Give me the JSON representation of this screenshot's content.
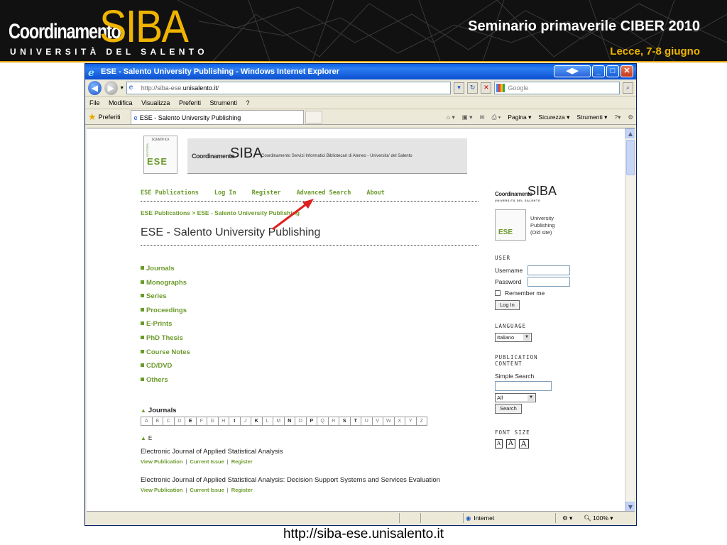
{
  "slide": {
    "logo_coord": "Coordinamento",
    "logo_siba": "SIBA",
    "logo_uni": "UNIVERSITÀ DEL SALENTO",
    "title": "Seminario primaverile CIBER 2010",
    "subtitle": "Lecce, 7-8 giugno",
    "footer_url": "http://siba-ese.unisalento.it"
  },
  "browser": {
    "window_title": "ESE - Salento University Publishing - Windows Internet Explorer",
    "address_prefix": "http://siba-ese.",
    "address_domain": "unisalento.it",
    "address_suffix": "/",
    "search_placeholder": "Google",
    "menu": [
      "File",
      "Modifica",
      "Visualizza",
      "Preferiti",
      "Strumenti",
      "?"
    ],
    "favorites_label": "Preferiti",
    "tab_title": "ESE - Salento University Publishing",
    "commands": [
      "Pagina ▾",
      "Sicurezza ▾",
      "Strumenti ▾"
    ],
    "status_zone": "Internet",
    "zoom": "100%"
  },
  "page": {
    "banner_coord": "Coordinamento",
    "banner_siba": "SIBA",
    "banner_desc": "Coordinamento Servizi Informatici Bibliotecari di Ateneo - Universita' del Salento",
    "ese_logo_top": "SCIENTIFICA",
    "ese_logo_side": "EDITORIA",
    "ese_logo_text": "ESE",
    "nav": [
      "ESE Publications",
      "Log In",
      "Register",
      "Advanced Search",
      "About"
    ],
    "breadcrumb": "ESE Publications > ESE - Salento University Publishing",
    "title": "ESE - Salento University Publishing",
    "categories": [
      "Journals",
      "Monographs",
      "Series",
      "Proceedings",
      "E-Prints",
      "PhD Thesis",
      "Course Notes",
      "CD/DVD",
      "Others"
    ],
    "journals_heading": "Journals",
    "alphabet": [
      "A",
      "B",
      "C",
      "D",
      "E",
      "F",
      "G",
      "H",
      "I",
      "J",
      "K",
      "L",
      "M",
      "N",
      "O",
      "P",
      "Q",
      "R",
      "S",
      "T",
      "U",
      "V",
      "W",
      "X",
      "Y",
      "Z"
    ],
    "alphabet_active": [
      "E",
      "I",
      "K",
      "N",
      "P",
      "S",
      "T"
    ],
    "letter_heading": "E",
    "journals": [
      {
        "title": "Electronic Journal of Applied Statistical Analysis",
        "links": [
          "View Publication",
          "Current Issue",
          "Register"
        ]
      },
      {
        "title": "Electronic Journal of Applied Statistical Analysis: Decision Support Systems and Services Evaluation",
        "links": [
          "View Publication",
          "Current Issue",
          "Register"
        ]
      }
    ]
  },
  "sidebar": {
    "logo_coord": "Coordinamento",
    "logo_siba": "SIBA",
    "logo_uni": "UNIVERSITÀ DEL SALENTO",
    "ese_text": "ESE",
    "ese_caption_1": "University",
    "ese_caption_2": "Publishing",
    "ese_caption_3": "(Old site)",
    "user_heading": "USER",
    "username_label": "Username",
    "password_label": "Password",
    "remember_label": "Remember me",
    "login_button": "Log In",
    "language_heading": "LANGUAGE",
    "language_value": "Italiano",
    "publication_heading_1": "PUBLICATION",
    "publication_heading_2": "CONTENT",
    "simple_search_label": "Simple Search",
    "search_scope": "All",
    "search_button": "Search",
    "font_size_heading": "FONT SIZE",
    "font_sizes": [
      "A",
      "A",
      "A"
    ]
  },
  "colors": {
    "accent_green": "#6b9a2b",
    "header_gold": "#f0b400",
    "header_bg": "#111111",
    "annotation_arrow": "#e02020"
  }
}
